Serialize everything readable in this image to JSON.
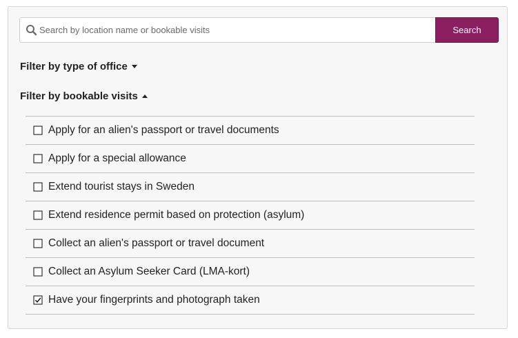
{
  "search": {
    "placeholder": "Search by location name or bookable visits",
    "value": "",
    "button_label": "Search"
  },
  "filters": {
    "office_type": {
      "label": "Filter by type of office",
      "expanded": false
    },
    "bookable_visits": {
      "label": "Filter by bookable visits",
      "expanded": true
    }
  },
  "visits": [
    {
      "label": "Apply for an alien's passport or travel documents",
      "checked": false
    },
    {
      "label": "Apply for a special allowance",
      "checked": false
    },
    {
      "label": "Extend tourist stays in Sweden",
      "checked": false
    },
    {
      "label": "Extend residence permit based on protection (asylum)",
      "checked": false
    },
    {
      "label": "Collect an alien's passport or travel document",
      "checked": false
    },
    {
      "label": "Collect an Asylum Seeker Card (LMA-kort)",
      "checked": false
    },
    {
      "label": "Have your fingerprints and photograph taken",
      "checked": true
    }
  ],
  "colors": {
    "accent": "#8b1e5f",
    "panel_bg": "#f7f7f7",
    "divider": "#bdbdbd"
  },
  "icons": {
    "search": "search-icon",
    "collapsed": "caret-down-icon",
    "expanded": "caret-up-icon",
    "unchecked": "checkbox-unchecked-icon",
    "checked": "checkbox-checked-icon"
  }
}
